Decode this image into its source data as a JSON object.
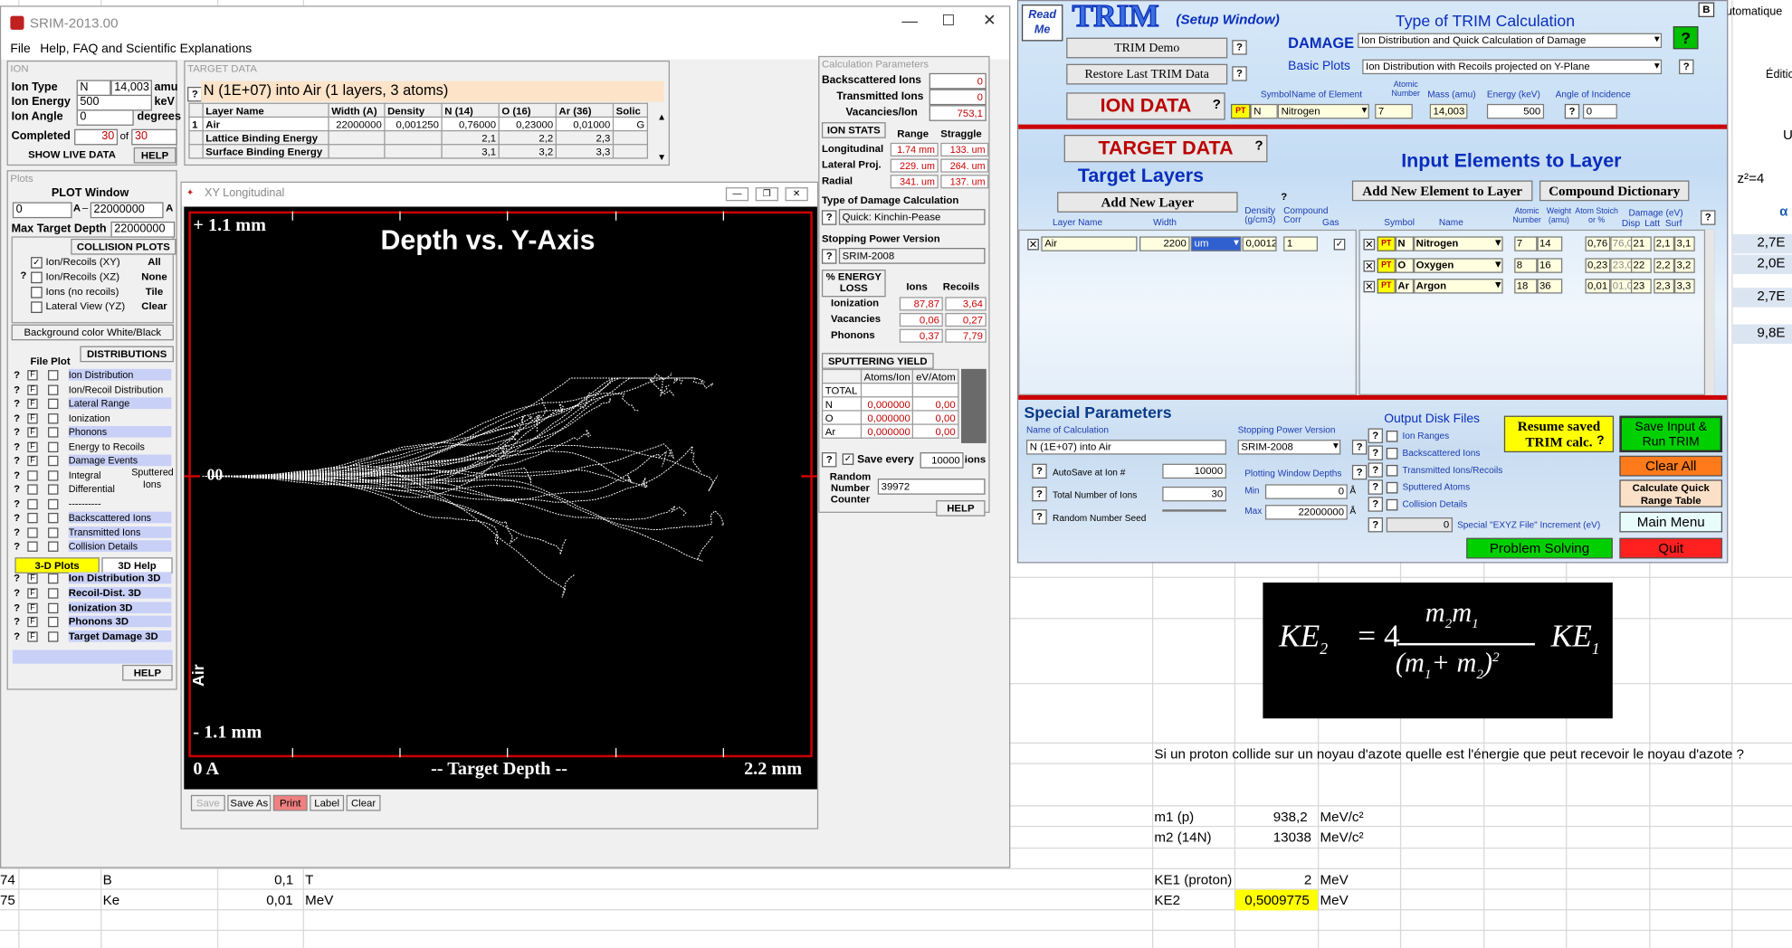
{
  "excel": {
    "top_right_1": "utomatique",
    "top_right_2": "Éditio",
    "col_U": "U",
    "z2": "z²=4",
    "col_alpha": "α",
    "blue_vals": [
      "2,7E",
      "2,0E",
      "2,7E",
      "9,8E"
    ],
    "row74": {
      "num": "74",
      "label": "B",
      "value": "0,1",
      "unit": "T"
    },
    "row75": {
      "num": "75",
      "label": "Ke",
      "value": "0,01",
      "unit": "MeV"
    },
    "question": "Si un proton collide sur un noyau d'azote quelle est l'énergie que peut recevoir le noyau d'azote ?",
    "rows": [
      {
        "label": "m1 (p)",
        "value": "938,2",
        "unit": "MeV/c²"
      },
      {
        "label": "m2 (14N)",
        "value": "13038",
        "unit": "MeV/c²"
      },
      {
        "label": "KE1 (proton)",
        "value": "2",
        "unit": "MeV"
      },
      {
        "label": "KE2",
        "value": "0,5009775",
        "unit": "MeV"
      }
    ],
    "formula": {
      "lhs": "KE",
      "lhs_sub": "2",
      "eq": "= 4",
      "num": "m",
      "num_sub1": "2",
      "num2": "m",
      "num_sub2": "1",
      "den": "(m",
      "den_sub1": "1",
      "den_mid": "+ m",
      "den_sub2": "2",
      "den_end": ")",
      "den_sup": "2",
      "rhs": "KE",
      "rhs_sub": "1"
    }
  },
  "srim": {
    "title": "SRIM-2013.00",
    "menu": [
      "File",
      "Help, FAQ and Scientific Explanations"
    ],
    "ion": {
      "title": "ION",
      "type_label": "Ion Type",
      "type": "N",
      "mass": "14,003",
      "mass_unit": "amu",
      "energy_label": "Ion Energy",
      "energy": "500",
      "energy_unit": "keV",
      "angle_label": "Ion Angle",
      "angle": "0",
      "angle_unit": "degrees",
      "completed_label": "Completed",
      "completed": "30",
      "of": "of",
      "total": "30",
      "show_live": "SHOW LIVE DATA",
      "help": "HELP"
    },
    "target": {
      "title": "TARGET DATA",
      "heading": "N (1E+07) into Air (1 layers, 3 atoms)",
      "headers": [
        "Layer Name",
        "Width (A)",
        "Density",
        "N (14)",
        "O (16)",
        "Ar (36)",
        "Solic"
      ],
      "rows": [
        [
          "1",
          "Air",
          "22000000",
          "0,001250",
          "0,76000",
          "0,23000",
          "0,01000",
          "G"
        ],
        [
          "",
          "Lattice Binding Energy",
          "",
          "",
          "2,1",
          "2,2",
          "2,3",
          ""
        ],
        [
          "",
          "Surface Binding Energy",
          "",
          "",
          "3,1",
          "3,2",
          "3,3",
          ""
        ]
      ]
    },
    "plots": {
      "title": "Plots",
      "window_label": "PLOT  Window",
      "min": "0",
      "a1": "A",
      "dash": "–",
      "max": "22000000",
      "a2": "A",
      "max_depth_label": "Max Target Depth",
      "max_depth": "22000000",
      "collision_title": "COLLISION PLOTS",
      "options": [
        "Ion/Recoils (XY)",
        "Ion/Recoils (XZ)",
        "Ions (no recoils)",
        "Lateral View (YZ)"
      ],
      "option_buttons": [
        "All",
        "None",
        "Tile",
        "Clear"
      ],
      "bg_btn": "Background color White/Black",
      "dist_title": "DISTRIBUTIONS",
      "file_plot": "File  Plot",
      "dists": [
        "Ion Distribution",
        "Ion/Recoil Distribution",
        "Lateral Range",
        "Ionization",
        "Phonons",
        "Energy to Recoils",
        "Damage Events",
        "Integral",
        "Differential",
        "----------",
        "Backscattered Ions",
        "Transmitted Ions",
        "Collision Details"
      ],
      "sputtered": "Sputtered",
      "ions": "Ions",
      "plots3d": "3-D Plots",
      "help3d": "3D Help",
      "d3": [
        "Ion Distribution 3D",
        "Recoil-Dist. 3D",
        "Ionization 3D",
        "Phonons 3D",
        "Target Damage 3D"
      ],
      "help": "HELP"
    },
    "calc": {
      "title": "Calculation Parameters",
      "rows": [
        {
          "label": "Backscattered Ions",
          "value": "0"
        },
        {
          "label": "Transmitted Ions",
          "value": "0"
        },
        {
          "label": "Vacancies/Ion",
          "value": "753,1"
        }
      ],
      "ionstats": "ION STATS",
      "range": "Range",
      "straggle": "Straggle",
      "stats": [
        {
          "label": "Longitudinal",
          "r": "1.74 mm",
          "s": "133. um"
        },
        {
          "label": "Lateral Proj.",
          "r": "229. um",
          "s": "264. um"
        },
        {
          "label": "Radial",
          "r": "341. um",
          "s": "137. um"
        }
      ],
      "damage_label": "Type of Damage Calculation",
      "damage": "Quick: Kinchin-Pease",
      "stop_label": "Stopping Power Version",
      "stop": "SRIM-2008",
      "eloss": "% ENERGY LOSS",
      "ions": "Ions",
      "recoils": "Recoils",
      "loss": [
        {
          "label": "Ionization",
          "i": "87,87",
          "r": "3,64"
        },
        {
          "label": "Vacancies",
          "i": "0,06",
          "r": "0,27"
        },
        {
          "label": "Phonons",
          "i": "0,37",
          "r": "7,79"
        }
      ],
      "sputter": "SPUTTERING YIELD",
      "atoms_ion": "Atoms/Ion",
      "ev_atom": "eV/Atom",
      "sp": [
        {
          "label": "TOTAL",
          "a": "",
          "e": ""
        },
        {
          "label": "N",
          "a": "0,000000",
          "e": "0,00"
        },
        {
          "label": "O",
          "a": "0,000000",
          "e": "0,00"
        },
        {
          "label": "Ar",
          "a": "0,000000",
          "e": "0,00"
        }
      ],
      "save_every": "Save every",
      "save_val": "10000",
      "save_unit": "ions",
      "random_label": "Random Number Counter",
      "random": "39972",
      "help": "HELP"
    }
  },
  "xy": {
    "title": "XY Longitudinal",
    "plot_title": "Depth vs. Y-Axis",
    "top": "+ 1.1 mm",
    "bottom": "- 1.1 mm",
    "origin": "00",
    "layer": "Air",
    "x0": "0 A",
    "xlabel": "-- Target Depth --",
    "xmax": "2.2 mm",
    "buttons": [
      "Save",
      "Save As",
      "Print",
      "Label",
      "Clear"
    ]
  },
  "trim": {
    "readme": "Read Me",
    "title": "TRIM",
    "subtitle": "(Setup Window)",
    "type_title": "Type of TRIM Calculation",
    "b": "B",
    "demo": "TRIM Demo",
    "restore": "Restore Last TRIM Data",
    "damage_label": "DAMAGE",
    "damage": "Ion Distribution and Quick Calculation of Damage",
    "basic_label": "Basic Plots",
    "basic": "Ion Distribution with Recoils projected on Y-Plane",
    "iondata": "ION DATA",
    "ion_headers": {
      "symbol": "Symbol",
      "name": "Name of Element",
      "atomic": "Atomic Number",
      "mass": "Mass (amu)",
      "energy": "Energy (keV)",
      "angle": "Angle of Incidence"
    },
    "ion": {
      "pt": "PT",
      "symbol": "N",
      "name": "Nitrogen",
      "z": "7",
      "mass": "14,003",
      "energy": "500",
      "angle": "0"
    },
    "targetdata": "TARGET DATA",
    "layers_title": "Target Layers",
    "add_layer": "Add New Layer",
    "layer_headers": {
      "name": "Layer Name",
      "width": "Width",
      "density": "Density (g/cm3)",
      "compound": "Compound Corr",
      "gas": "Gas"
    },
    "layer": {
      "name": "Air",
      "width": "2200",
      "unit": "um",
      "density": "0,0012",
      "corr": "1"
    },
    "elements_title": "Input Elements to Layer",
    "add_element": "Add New Element to Layer",
    "compound_dict": "Compound Dictionary",
    "el_headers": {
      "symbol": "Symbol",
      "name": "Name",
      "atomic": "Atomic Number",
      "weight": "Weight (amu)",
      "stoich": "Atom Stoich or %",
      "damage": "Damage (eV)",
      "disp": "Disp",
      "latt": "Latt",
      "surf": "Surf"
    },
    "elements": [
      {
        "sym": "N",
        "name": "Nitrogen",
        "z": "7",
        "w": "14",
        "st": "0,76",
        "pct": "76,0",
        "d": "21",
        "l": "2,1",
        "s": "3,1"
      },
      {
        "sym": "O",
        "name": "Oxygen",
        "z": "8",
        "w": "16",
        "st": "0,23",
        "pct": "23,0",
        "d": "22",
        "l": "2,2",
        "s": "3,2"
      },
      {
        "sym": "Ar",
        "name": "Argon",
        "z": "18",
        "w": "36",
        "st": "0,01",
        "pct": "01,0",
        "d": "23",
        "l": "2,3",
        "s": "3,3"
      }
    ],
    "special": "Special Parameters",
    "calc_name_label": "Name of Calculation",
    "calc_name": "N (1E+07) into Air",
    "stop_label": "Stopping Power Version",
    "stop": "SRIM-2008",
    "autosave_label": "AutoSave at Ion #",
    "autosave": "10000",
    "total_label": "Total Number of Ions",
    "total": "30",
    "seed_label": "Random Number Seed",
    "seed": "",
    "depths_label": "Plotting Window Depths",
    "min_label": "Min",
    "min": "0",
    "max_label": "Max",
    "max": "22000000",
    "a": "Å",
    "output": "Output Disk Files",
    "outputs": [
      "Ion Ranges",
      "Backscattered Ions",
      "Transmitted Ions/Recoils",
      "Sputtered Atoms",
      "Collision Details"
    ],
    "special_ev": "Special \"EXYZ File\" Increment (eV)",
    "special_val": "0",
    "resume": "Resume saved TRIM calc.",
    "save_run": "Save Input & Run TRIM",
    "clear_all": "Clear All",
    "quick": "Calculate Quick Range Table",
    "main_menu": "Main Menu",
    "problem": "Problem Solving",
    "quit": "Quit"
  },
  "colors": {
    "excel_blue": "#dbe5f1",
    "highlight": "#ffff00",
    "trim_blue": "#0a2ebb",
    "red": "#c00000"
  }
}
